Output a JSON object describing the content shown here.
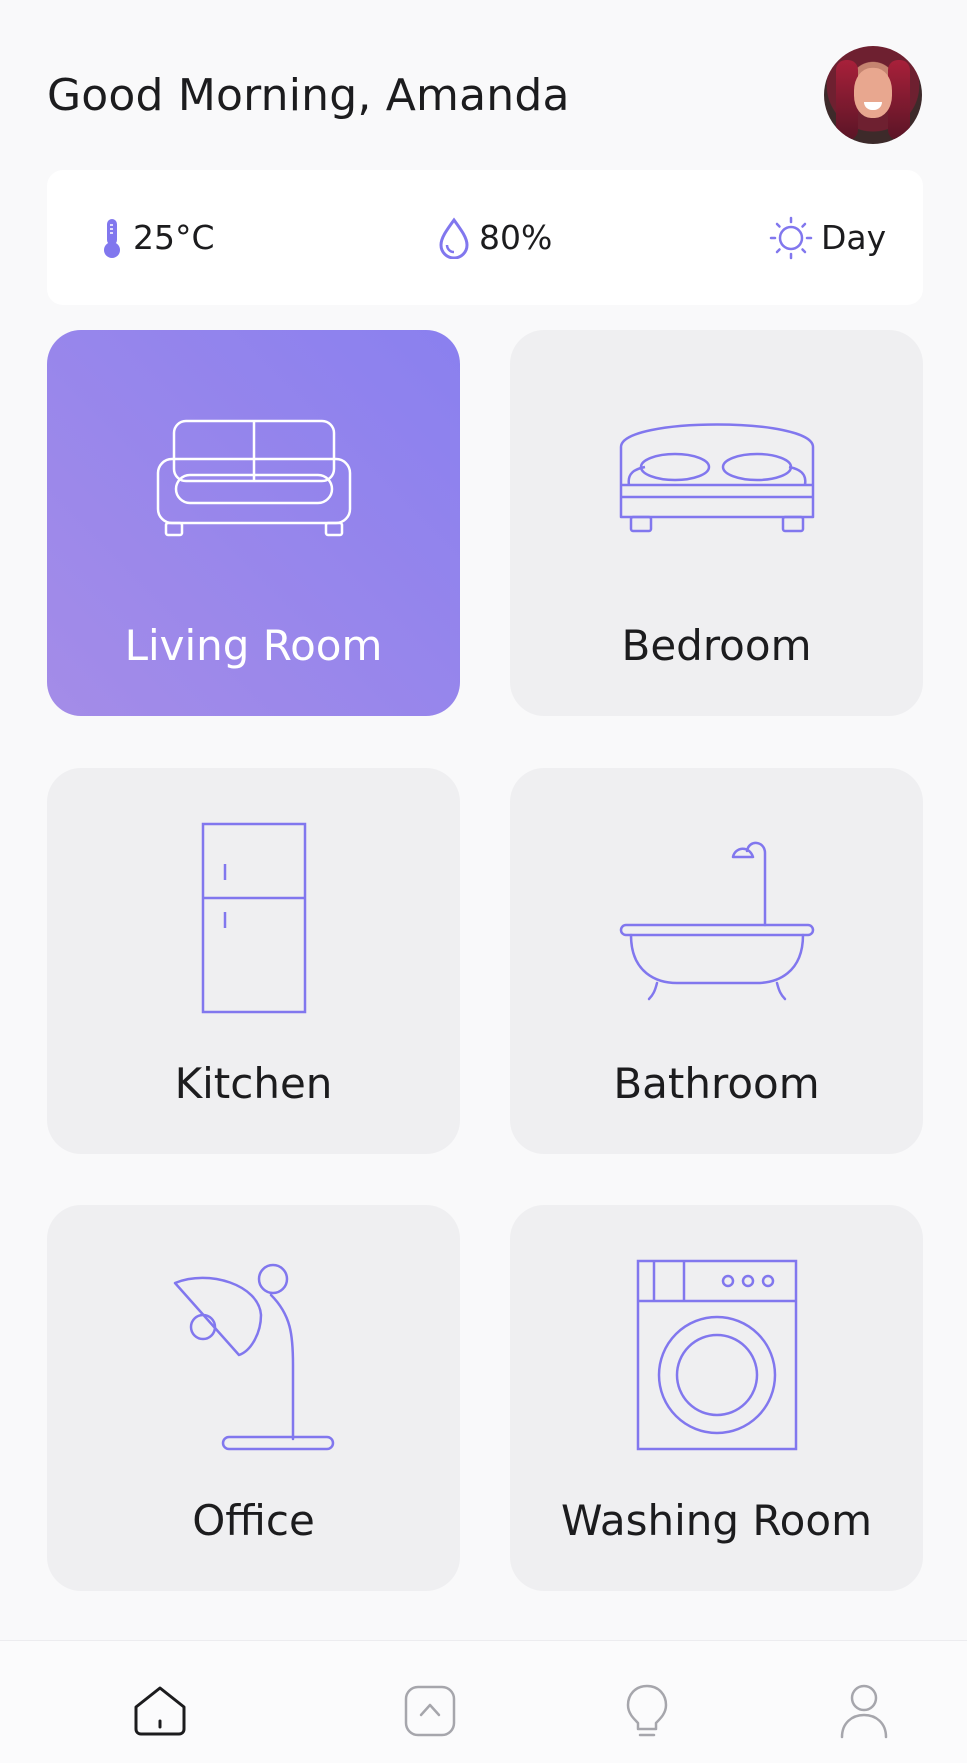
{
  "header": {
    "greeting": "Good Morning, Amanda"
  },
  "stats": {
    "temperature": "25°C",
    "humidity": "80%",
    "time_of_day": "Day"
  },
  "rooms": [
    {
      "label": "Living Room",
      "icon": "sofa-icon",
      "active": true
    },
    {
      "label": "Bedroom",
      "icon": "bed-icon",
      "active": false
    },
    {
      "label": "Kitchen",
      "icon": "fridge-icon",
      "active": false
    },
    {
      "label": "Bathroom",
      "icon": "bathtub-icon",
      "active": false
    },
    {
      "label": "Office",
      "icon": "desk-lamp-icon",
      "active": false
    },
    {
      "label": "Washing Room",
      "icon": "washing-machine-icon",
      "active": false
    }
  ],
  "bottom_nav": [
    {
      "icon": "home-icon",
      "active": true
    },
    {
      "icon": "chevron-up-square-icon",
      "active": false
    },
    {
      "icon": "lightbulb-icon",
      "active": false
    },
    {
      "icon": "user-icon",
      "active": false
    }
  ],
  "colors": {
    "accent": "#7f77ee",
    "card_bg": "#efeff1",
    "active_gradient_start": "#8a80ef",
    "active_gradient_end": "#a48ce8",
    "page_bg": "#f9f9fa"
  }
}
